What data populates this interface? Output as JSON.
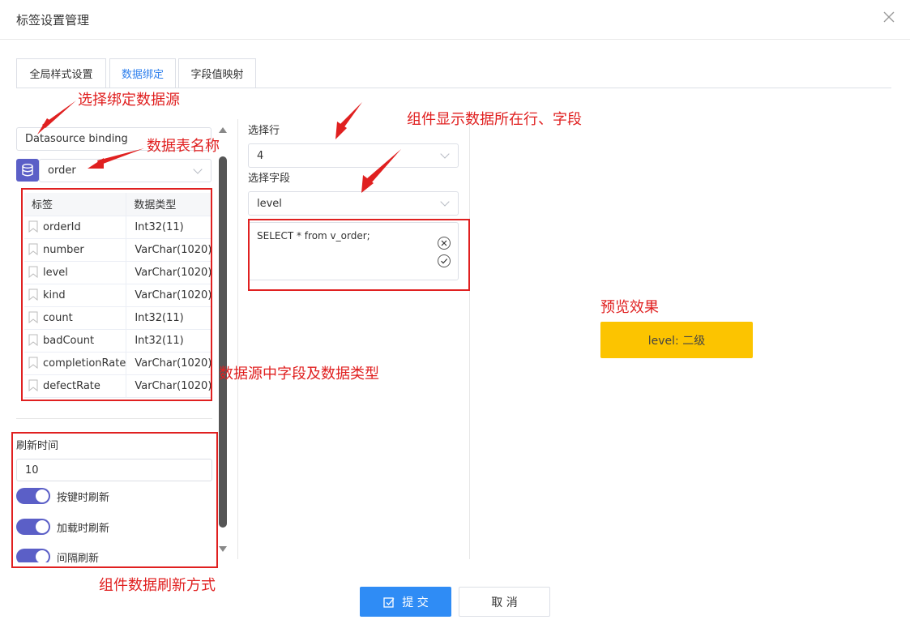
{
  "dialog": {
    "title": "标签设置管理"
  },
  "tabs": [
    {
      "label": "全局样式设置"
    },
    {
      "label": "数据绑定"
    },
    {
      "label": "字段值映射"
    }
  ],
  "datasource": {
    "binding_label": "Datasource binding",
    "table_name": "order"
  },
  "fields_table": {
    "headers": [
      "标签",
      "数据类型"
    ],
    "rows": [
      [
        "orderId",
        "Int32(11)"
      ],
      [
        "number",
        "VarChar(1020)"
      ],
      [
        "level",
        "VarChar(1020)"
      ],
      [
        "kind",
        "VarChar(1020)"
      ],
      [
        "count",
        "Int32(11)"
      ],
      [
        "badCount",
        "Int32(11)"
      ],
      [
        "completionRate",
        "VarChar(1020)"
      ],
      [
        "defectRate",
        "VarChar(1020)"
      ]
    ]
  },
  "refresh": {
    "title": "刷新时间",
    "interval_value": "10",
    "toggles": [
      {
        "label": "按键时刷新",
        "on": true
      },
      {
        "label": "加载时刷新",
        "on": true
      },
      {
        "label": "间隔刷新",
        "on": true
      }
    ]
  },
  "row_select": {
    "label": "选择行",
    "value": "4"
  },
  "field_select": {
    "label": "选择字段",
    "value": "level"
  },
  "sql": {
    "text": "SELECT * from v_order;"
  },
  "preview": {
    "text": "level: 二级"
  },
  "annotations": {
    "select_datasource": "选择绑定数据源",
    "table_name": "数据表名称",
    "fields_types": "数据源中字段及数据类型",
    "refresh_mode": "组件数据刷新方式",
    "row_field": "组件显示数据所在行、字段",
    "preview_effect": "预览效果"
  },
  "buttons": {
    "submit": "提 交",
    "cancel": "取 消"
  },
  "colors": {
    "primary": "#2f8cf5",
    "toggle": "#5b5fc7",
    "preview_bg": "#fcc400",
    "annotation": "#e02020"
  }
}
